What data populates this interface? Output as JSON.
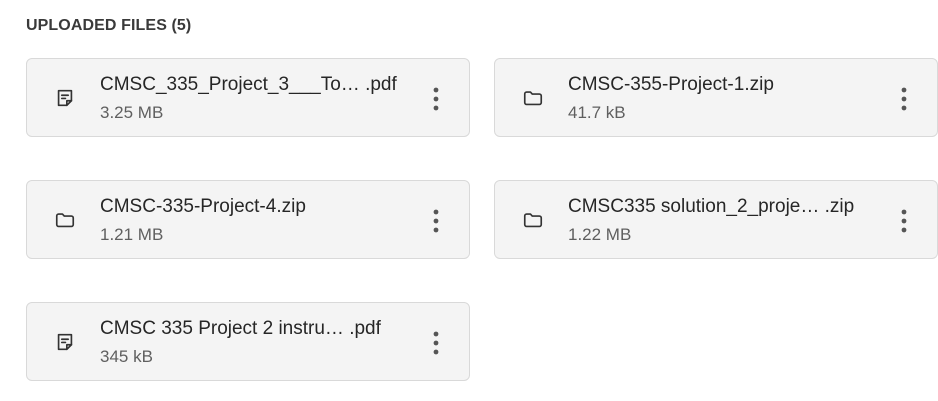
{
  "section": {
    "title": "UPLOADED FILES (5)"
  },
  "files": [
    {
      "name": "CMSC_335_Project_3___To… .pdf",
      "size": "3.25 MB",
      "icon": "document-icon"
    },
    {
      "name": "CMSC-355-Project-1.zip",
      "size": "41.7 kB",
      "icon": "folder-icon"
    },
    {
      "name": "CMSC-335-Project-4.zip",
      "size": "1.21 MB",
      "icon": "folder-icon"
    },
    {
      "name": "CMSC335 solution_2_proje… .zip",
      "size": "1.22 MB",
      "icon": "folder-icon"
    },
    {
      "name": "CMSC 335 Project 2 instru… .pdf",
      "size": "345 kB",
      "icon": "document-icon"
    }
  ],
  "more_menu_icon": "more-vertical-icon"
}
